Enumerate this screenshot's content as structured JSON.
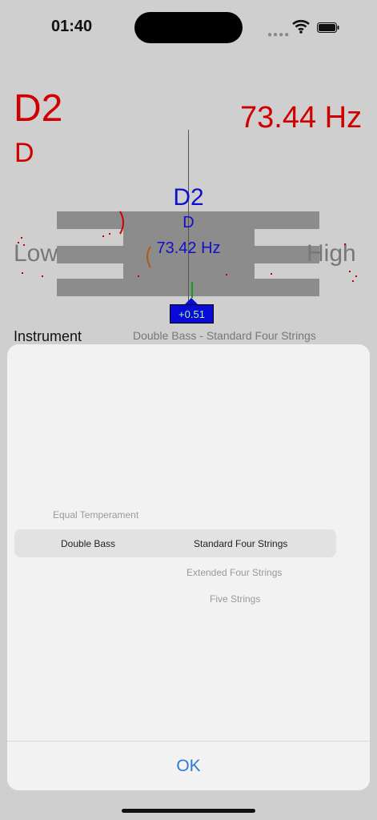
{
  "status_bar": {
    "time": "01:40",
    "signal_icon": "signal-dots-icon",
    "wifi_icon": "wifi-icon",
    "battery_icon": "battery-icon"
  },
  "readout": {
    "note": "D2",
    "letter": "D",
    "frequency": "73.44 Hz"
  },
  "gauge": {
    "center_note": "D2",
    "center_letter": "D",
    "center_frequency": "73.42 Hz",
    "low_label": "Low",
    "high_label": "High",
    "cents_offset": "+0.51"
  },
  "instrument": {
    "label": "Instrument",
    "value": "Double Bass - Standard Four Strings"
  },
  "picker": {
    "column1": {
      "above": "Equal Temperament",
      "selected": "Double Bass"
    },
    "column2": {
      "selected": "Standard Four Strings",
      "below": [
        "Extended Four Strings",
        "Five Strings"
      ]
    }
  },
  "sheet": {
    "ok_label": "OK"
  },
  "colors": {
    "note_red": "#d00000",
    "tuner_blue": "#1010c8",
    "accent": "#2a7ad6"
  }
}
